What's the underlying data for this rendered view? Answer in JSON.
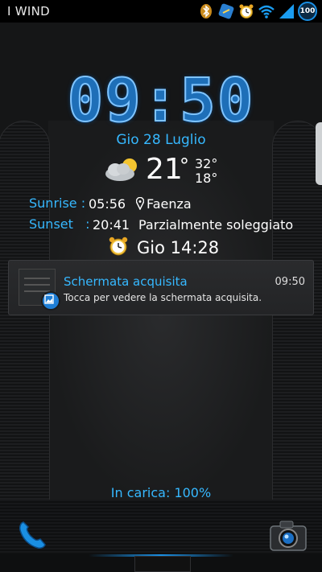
{
  "status_bar": {
    "carrier": "I WIND",
    "battery_level": "100",
    "icons": [
      "bluetooth-icon",
      "data-sync-icon",
      "alarm-icon",
      "wifi-icon",
      "signal-icon",
      "battery-icon"
    ]
  },
  "lockscreen": {
    "time": "09:50",
    "date": "Gio 28 Luglio",
    "weather": {
      "temperature": "21",
      "degree_symbol": "°",
      "high": "32°",
      "low": "18°",
      "icon": "partly-cloudy-icon"
    },
    "sunrise_label": "Sunrise :",
    "sunrise_time": "05:56",
    "location": "Faenza",
    "sunset_label": "Sunset   :",
    "sunset_time": "20:41",
    "condition": "Parzialmente soleggiato",
    "next_alarm": "Gio 14:28",
    "charging": "In carica: 100%"
  },
  "notification": {
    "title": "Schermata acquisita",
    "time": "09:50",
    "text": "Tocca per vedere la schermata acquisita."
  },
  "colors": {
    "accent": "#36b8ff",
    "clock": "#1e6fb8",
    "background": "#151617"
  }
}
